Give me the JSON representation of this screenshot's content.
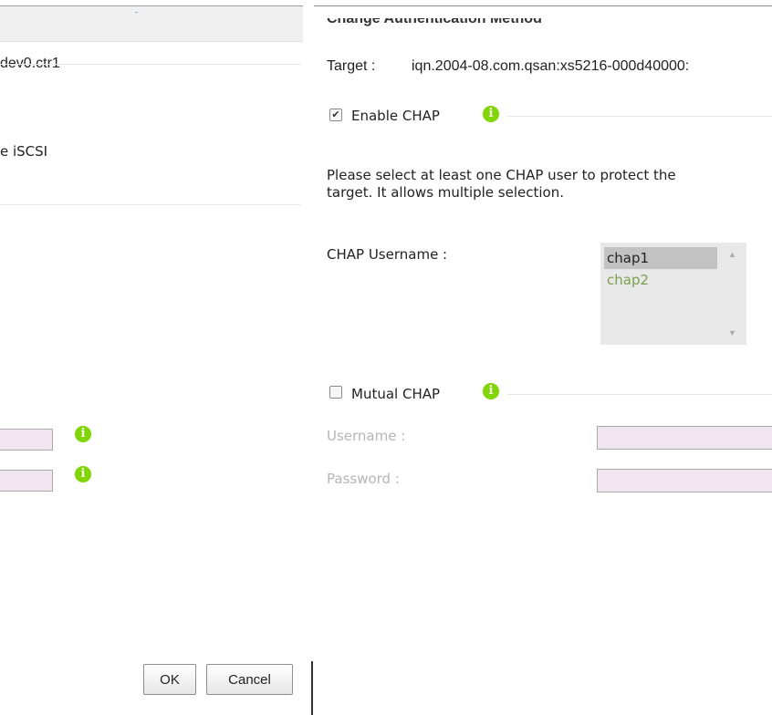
{
  "left_dialog": {
    "row1_text": "dev0.ctr1",
    "row2_text": "e iSCSI",
    "ok_label": "OK",
    "cancel_label": "Cancel"
  },
  "right_dialog": {
    "title": "Change Authentication Method",
    "target_label": "Target :",
    "target_value": "iqn.2004-08.com.qsan:xs5216-000d40000:",
    "enable_chap": {
      "label": "Enable CHAP",
      "checked": true
    },
    "instruction_line1": "Please select at least one CHAP user to protect the",
    "instruction_line2": "target. It allows multiple selection.",
    "chap_username_label": "CHAP Username :",
    "chap_users": [
      "chap1",
      "chap2"
    ],
    "selected_user": "chap1",
    "mutual_chap": {
      "label": "Mutual CHAP",
      "checked": false
    },
    "username_label": "Username :",
    "password_label": "Password :"
  },
  "colors": {
    "info_icon": "#7fd600",
    "input_bg": "#f1e6ef",
    "listbox_bg": "#e8e8e8",
    "selected_option_bg": "#c2c2c2",
    "unselected_option_text": "#7aa04a",
    "disabled_label": "#b5b5b5"
  },
  "icons": {
    "info": "info-icon",
    "checkbox_checked": "check-icon",
    "scroll_up": "scroll-up-arrow-icon",
    "scroll_down": "scroll-down-arrow-icon"
  }
}
